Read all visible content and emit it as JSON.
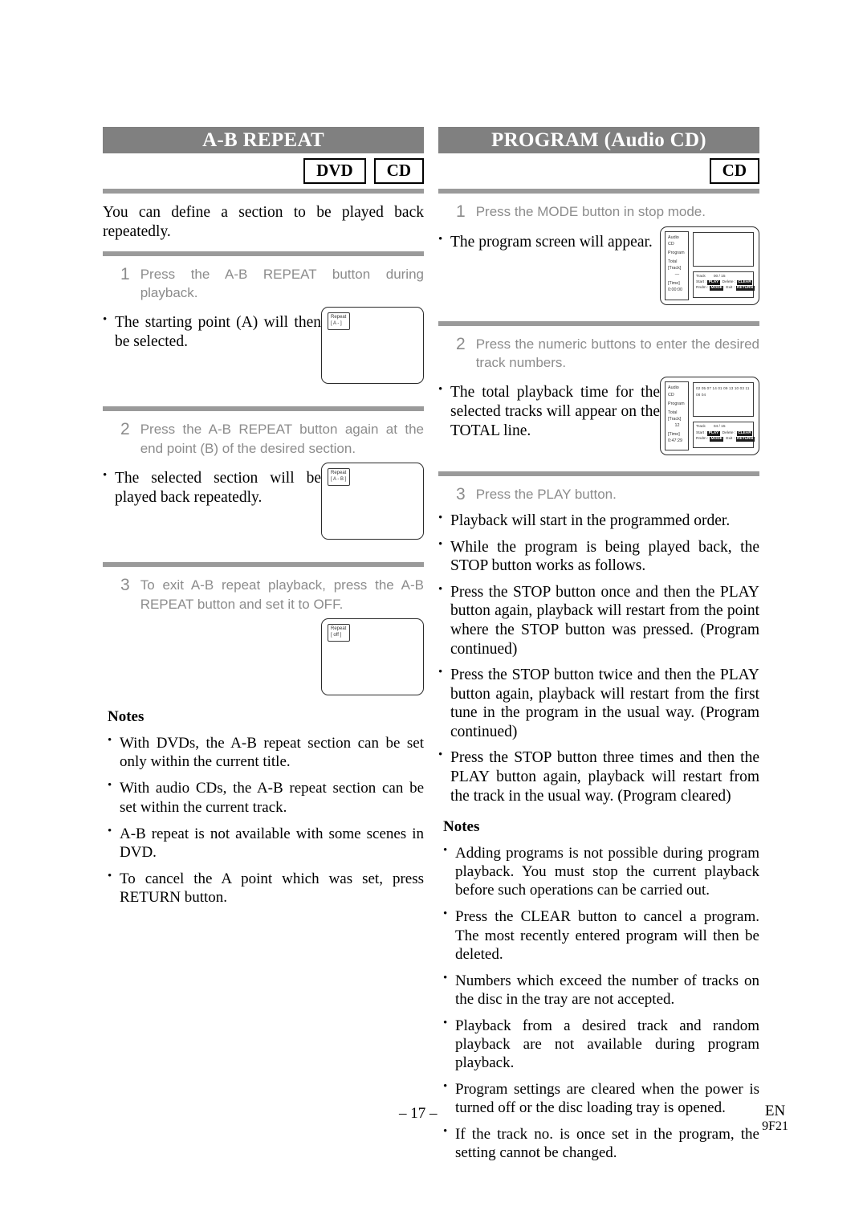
{
  "page": {
    "number": "– 17 –",
    "lang_code": "EN",
    "doc_code": "9F21"
  },
  "left": {
    "title": "A-B REPEAT",
    "badges": [
      "DVD",
      "CD"
    ],
    "lead": "You can define a section to be played back repeatedly.",
    "steps": [
      {
        "num": "1",
        "text": "Press the A-B REPEAT button during playback."
      },
      {
        "num": "2",
        "text": "Press the A-B REPEAT button again at the end point (B) of the desired section."
      },
      {
        "num": "3",
        "text": "To exit A-B repeat playback, press the A-B REPEAT button and set it to OFF."
      }
    ],
    "bullets": [
      "The starting point (A) will then be selected.",
      "The selected section will be played back repeatedly."
    ],
    "screens": [
      {
        "line1": "Repeat",
        "line2": "[ A -    ]"
      },
      {
        "line1": "Repeat",
        "line2": "[ A - B ]"
      },
      {
        "line1": "Repeat",
        "line2": "[ off ]"
      }
    ],
    "notes_heading": "Notes",
    "notes": [
      "With DVDs, the A-B repeat section can be set only within the current title.",
      "With audio CDs, the A-B repeat section can be set within the current track.",
      "A-B repeat is not available with some scenes in DVD.",
      "To cancel the A point which was set, press RETURN button."
    ]
  },
  "right": {
    "title": "PROGRAM (Audio CD)",
    "badges": [
      "CD"
    ],
    "steps": [
      {
        "num": "1",
        "text": "Press the MODE button in stop mode."
      },
      {
        "num": "2",
        "text": "Press the numeric buttons to enter the desired track numbers."
      },
      {
        "num": "3",
        "text": "Press the PLAY button."
      }
    ],
    "bullets_step1": [
      "The program screen will appear."
    ],
    "bullets_step2": [
      "The total playback time for the selected tracks will appear on the TOTAL line."
    ],
    "bullets_step3": [
      "Playback will start in the programmed order.",
      "While the program is being played back, the STOP button works as follows.",
      "Press the STOP button once and then the PLAY button again, playback will restart from the point where the STOP button was pressed. (Program continued)",
      "Press the STOP button twice and then the PLAY button again, playback will restart from the first tune in the program in the usual way. (Program continued)",
      "Press the STOP button three times and then the PLAY button again, playback will restart from the track in the usual way. (Program cleared)"
    ],
    "program_screens": [
      {
        "disc_label": "Audio CD",
        "mode_label": "Program",
        "total_label": "Total",
        "track_label": "[Track]",
        "track_value": "—",
        "time_label": "[Time]",
        "time_value": "0:00:00",
        "track_list_line1": "",
        "track_list_line2": "",
        "info_track_label": "Track",
        "info_track_value": "00 / 15",
        "info_start_label": "Start :",
        "info_start_key": "PLAY",
        "info_delete_label": "Delete :",
        "info_delete_key": "CLEAR",
        "info_random_label": "Rndm :",
        "info_random_key": "MODE",
        "info_exit_label": "Exit :",
        "info_exit_key": "RETURN"
      },
      {
        "disc_label": "Audio CD",
        "mode_label": "Program",
        "total_label": "Total",
        "track_label": "[Track]",
        "track_value": "12",
        "time_label": "[Time]",
        "time_value": "0:47:29",
        "track_list_line1": "02 05 07 14 01 09 13 10 03 11",
        "track_list_line2": "08 04",
        "info_track_label": "Track",
        "info_track_value": "04 / 15",
        "info_start_label": "Start :",
        "info_start_key": "PLAY",
        "info_delete_label": "Delete :",
        "info_delete_key": "CLEAR",
        "info_random_label": "Rndm :",
        "info_random_key": "MODE",
        "info_exit_label": "Exit :",
        "info_exit_key": "RETURN"
      }
    ],
    "notes_heading": "Notes",
    "notes": [
      "Adding programs is not possible during program playback. You must stop the current playback before such operations can be carried out.",
      "Press the CLEAR button to cancel a program. The most recently entered program will then be deleted.",
      "Numbers which exceed the number of tracks on the disc in the tray are not accepted.",
      "Playback from a desired track and random playback are not available during program playback.",
      "Program settings are cleared when the power is turned off or the disc loading tray is opened.",
      "If the track no. is once set in the program, the setting cannot be changed."
    ]
  }
}
